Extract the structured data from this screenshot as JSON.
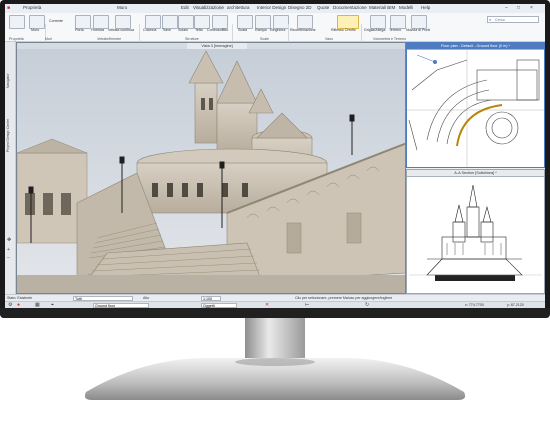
{
  "menu": [
    "Proprietà",
    "Muro",
    "Edit",
    "Visualizzazione",
    "architettura",
    "Interior Design",
    "Disegno 2D",
    "Quote",
    "Documentazione",
    "Materiali BIM",
    "Modelli",
    "Help"
  ],
  "ribbon": {
    "buttons": [
      "Muro",
      "Corrente",
      "Porta",
      "Finestra",
      "Vetrata continua",
      "Colonna",
      "Trave",
      "Solaio",
      "Tetto",
      "Controsoffitto",
      "Scala",
      "Rampa",
      "Ringhiera",
      "Ricombinazione",
      "Riflesso Orrofio",
      "Griglia/Allega",
      "Terreno",
      "Nuvola di Punti"
    ],
    "groups": [
      "Proprietà",
      "Muri",
      "Vetrate/finestre",
      "Strutture",
      "Scale",
      "Vano",
      "Volumetria e Terreno"
    ]
  },
  "search_placeholder": "Cerca",
  "dock_tabs": [
    "Navigator",
    "Project Design Center"
  ],
  "views": {
    "v3d_title": "Vista 3 [Immagine]",
    "plan_title": "Floor plan - Default - Ground floor (0 m) *",
    "section_title": "A-A Section [Sottolinea] *"
  },
  "status": {
    "layer": "Stato: Esistente",
    "filter": "Tutti",
    "height": "Alto",
    "scale": "1:100",
    "hint": "Clic per selezionare, premere Maiusc per aggiungere/togliere",
    "coord_x": "x: 774.7700",
    "coord_y": "y: 87.2120",
    "floor": "Ground floor",
    "snap": "Oggetti"
  },
  "colors": {
    "accent": "#4f7bc0",
    "stone": "#c9c0b2",
    "stone_dark": "#8f8677",
    "sky": "#d5dbe2"
  }
}
